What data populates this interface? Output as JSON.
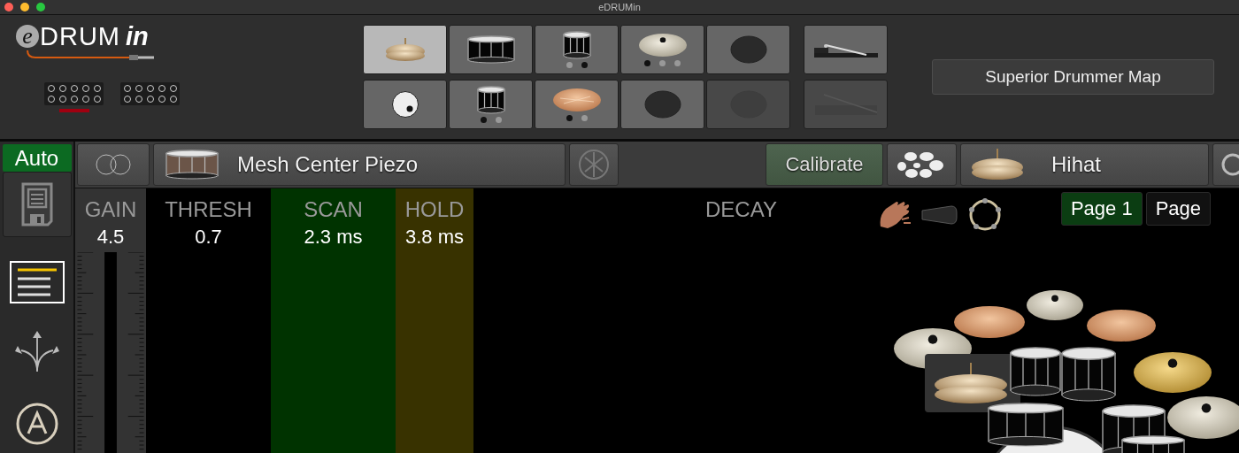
{
  "window": {
    "title": "eDRUMin"
  },
  "logo": {
    "badge": "e",
    "main": "DRUM",
    "tail": "in"
  },
  "inputs": [
    {
      "active": true
    },
    {
      "active": false
    }
  ],
  "pads": [
    {
      "kind": "hihat",
      "selected": true,
      "disabled": false
    },
    {
      "kind": "snare",
      "selected": false,
      "disabled": false
    },
    {
      "kind": "tom",
      "selected": false,
      "disabled": false,
      "zones": [
        {
          "on": false
        },
        {
          "on": true
        }
      ]
    },
    {
      "kind": "ride",
      "selected": false,
      "disabled": false,
      "zones": [
        {
          "on": true
        },
        {
          "on": false
        },
        {
          "on": false
        }
      ]
    },
    {
      "kind": "pad",
      "selected": false,
      "disabled": false
    },
    {
      "kind": "kick",
      "selected": false,
      "disabled": false
    },
    {
      "kind": "tom",
      "selected": false,
      "disabled": false,
      "zones": [
        {
          "on": true
        },
        {
          "on": false
        }
      ]
    },
    {
      "kind": "crash",
      "selected": false,
      "disabled": false,
      "zones": [
        {
          "on": true
        },
        {
          "on": false
        }
      ]
    },
    {
      "kind": "pad",
      "selected": false,
      "disabled": false
    },
    {
      "kind": "pad",
      "selected": false,
      "disabled": true
    }
  ],
  "pedals": [
    {
      "kind": "hihat-pedal",
      "disabled": false
    },
    {
      "kind": "pedal",
      "disabled": true
    }
  ],
  "map_button": "Superior Drummer Map",
  "auto": {
    "label": "Auto",
    "on": true
  },
  "sidebar_tools": [
    {
      "kind": "list",
      "selected": true
    },
    {
      "kind": "routing",
      "selected": false
    },
    {
      "kind": "auto",
      "selected": false
    }
  ],
  "toolbar": {
    "pad_name": "Mesh Center Piezo",
    "calibrate": "Calibrate",
    "instrument": "Hihat"
  },
  "params": [
    {
      "kind": "gain",
      "label": "GAIN",
      "value": "4.5",
      "color": "#333333"
    },
    {
      "kind": "plain",
      "label": "THRESH",
      "value": "0.7",
      "color": "#000000"
    },
    {
      "kind": "plain",
      "label": "SCAN",
      "value": "2.3 ms",
      "color": "#003300"
    },
    {
      "kind": "plain",
      "label": "HOLD",
      "value": "3.8 ms",
      "color": "#383200"
    }
  ],
  "decay": {
    "label": "DECAY"
  },
  "pages": [
    {
      "label": "Page 1",
      "selected": true
    },
    {
      "label": "Page",
      "selected": false
    }
  ]
}
